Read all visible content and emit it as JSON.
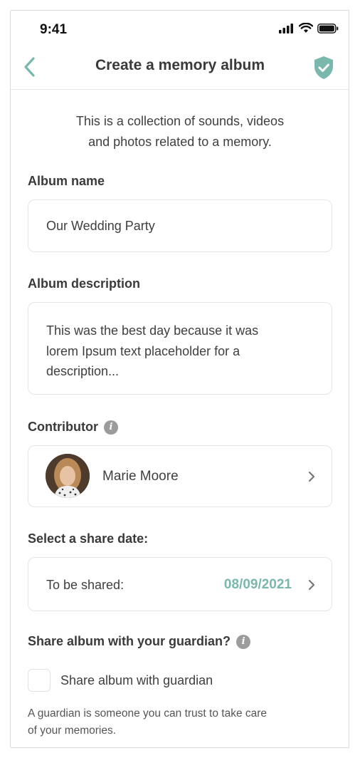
{
  "status_bar": {
    "time": "9:41"
  },
  "header": {
    "title": "Create a memory album"
  },
  "intro": {
    "line1": "This is a collection of sounds, videos",
    "line2": "and photos related to a memory."
  },
  "album_name": {
    "label": "Album name",
    "value": "Our Wedding Party"
  },
  "album_description": {
    "label": "Album description",
    "line1": "This was the best day because it was",
    "line2": "lorem Ipsum text placeholder for a",
    "line3": "description..."
  },
  "contributor": {
    "label": "Contributor",
    "name": "Marie Moore"
  },
  "share_date": {
    "label": "Select a share date:",
    "row_label": "To be shared:",
    "value": "08/09/2021"
  },
  "guardian": {
    "label": "Share album with your guardian?",
    "checkbox_label": "Share album with guardian",
    "checked": false,
    "footnote_line1": "A guardian is someone you can trust to take care",
    "footnote_line2": "of your memories."
  },
  "colors": {
    "accent": "#7ab8ad",
    "text": "#3a3a3a",
    "border": "#e3e6e6"
  },
  "icons": [
    "signal-icon",
    "wifi-icon",
    "battery-icon",
    "back-arrow-icon",
    "shield-check-icon",
    "info-icon",
    "chevron-right-icon"
  ]
}
